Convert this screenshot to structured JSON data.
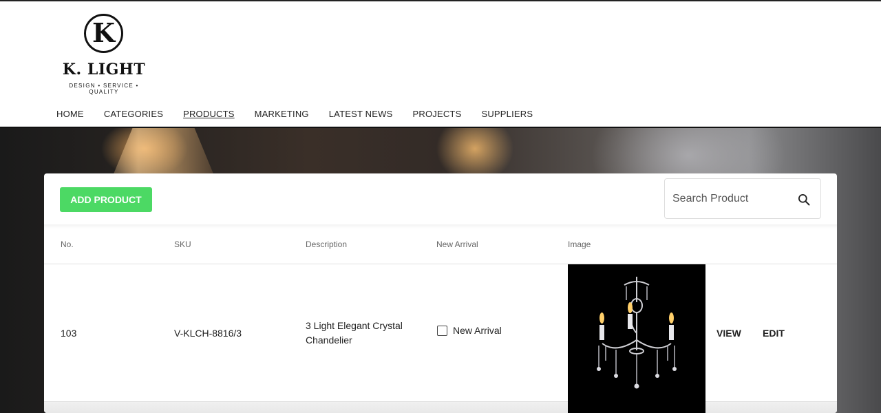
{
  "brand": {
    "logo_letter": "K",
    "name": "K. LIGHT",
    "tagline": "DESIGN • SERVICE • QUALITY"
  },
  "nav": {
    "home": "HOME",
    "categories": "CATEGORIES",
    "products": "PRODUCTS",
    "marketing": "MARKETING",
    "latest_news": "LATEST NEWS",
    "projects": "PROJECTS",
    "suppliers": "SUPPLIERS",
    "active": "PRODUCTS"
  },
  "toolbar": {
    "add_product_label": "ADD PRODUCT",
    "search_placeholder": "Search Product",
    "search_value": "",
    "search_icon": "search-icon"
  },
  "table": {
    "headers": {
      "no": "No.",
      "sku": "SKU",
      "description": "Description",
      "new_arrival": "New Arrival",
      "image": "Image"
    },
    "rows": [
      {
        "no": "103",
        "sku": "V-KLCH-8816/3",
        "description": "3 Light Elegant Crystal Chandelier",
        "new_arrival_checked": false,
        "new_arrival_label": "New Arrival",
        "view_label": "VIEW",
        "edit_label": "EDIT"
      }
    ]
  },
  "colors": {
    "add_button": "#4cd964",
    "text": "#222222",
    "header_border": "#111111"
  }
}
